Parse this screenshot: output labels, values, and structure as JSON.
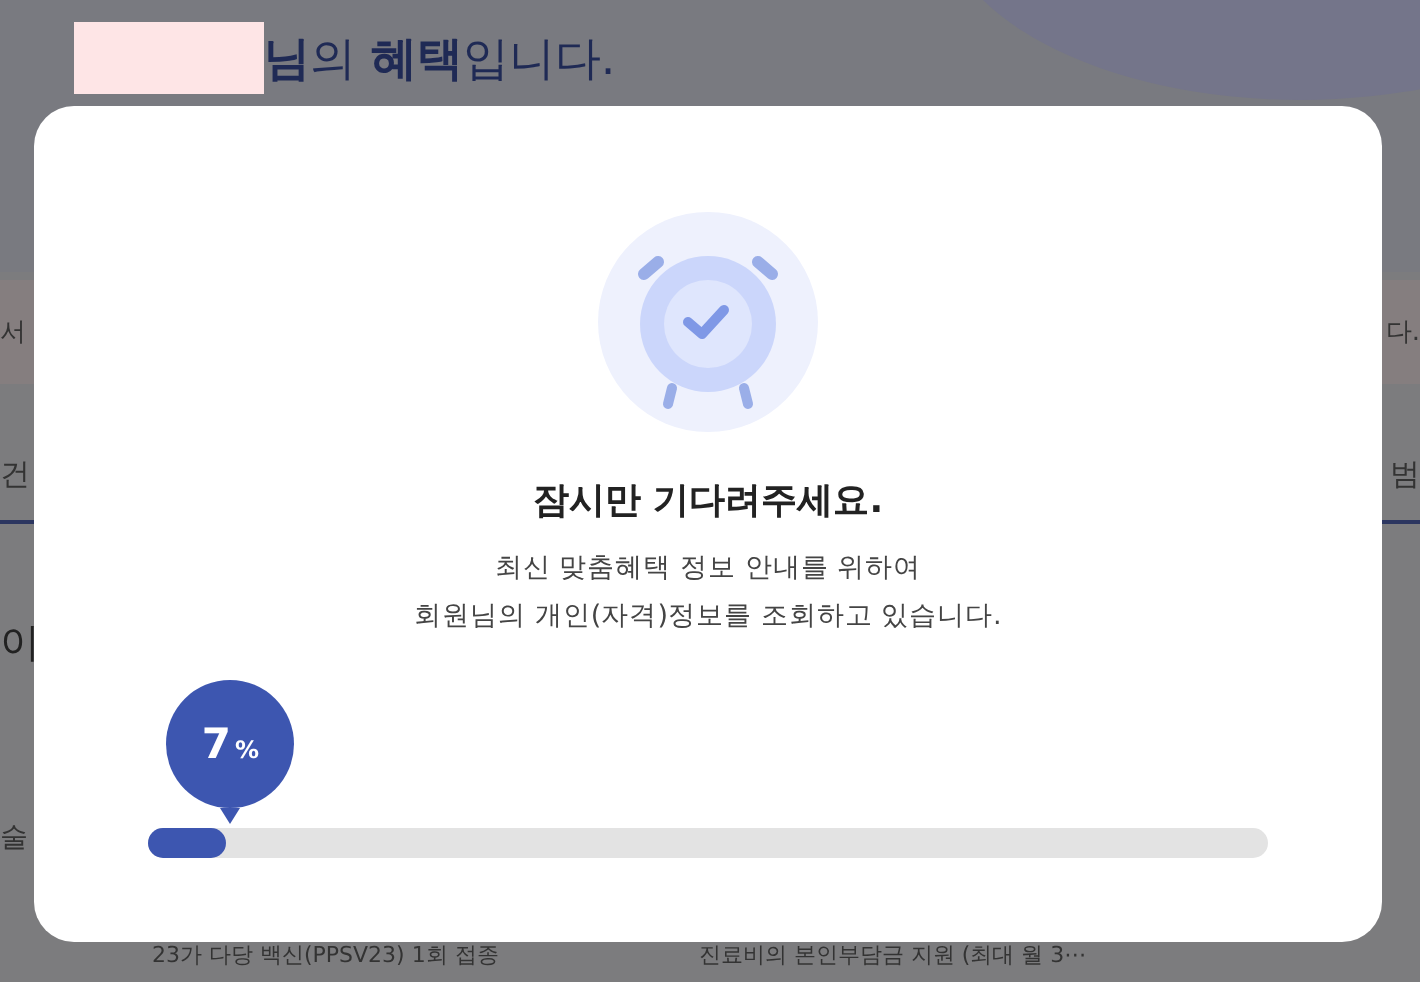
{
  "background_page": {
    "greeting": "**님**의 **혜택**입니다.",
    "notice_left": "서",
    "notice_right": "다.",
    "tab_left": "건",
    "tab_right": "범",
    "section_heading": "이",
    "row_label": "술",
    "cards": [
      "23가 다당 백신(PPSV23) 1회 접종",
      "진료비의 본인부담금 지원 (최대 월 3⋯"
    ]
  },
  "modal": {
    "title": "잠시만 기다려주세요.",
    "message": [
      "최신 맞춤혜택 정보 안내를 위하여",
      "회원님의 개인(자격)정보를 조회하고 있습니다."
    ],
    "progress": {
      "level": 0.07,
      "value": "7",
      "unit": "%"
    }
  }
}
